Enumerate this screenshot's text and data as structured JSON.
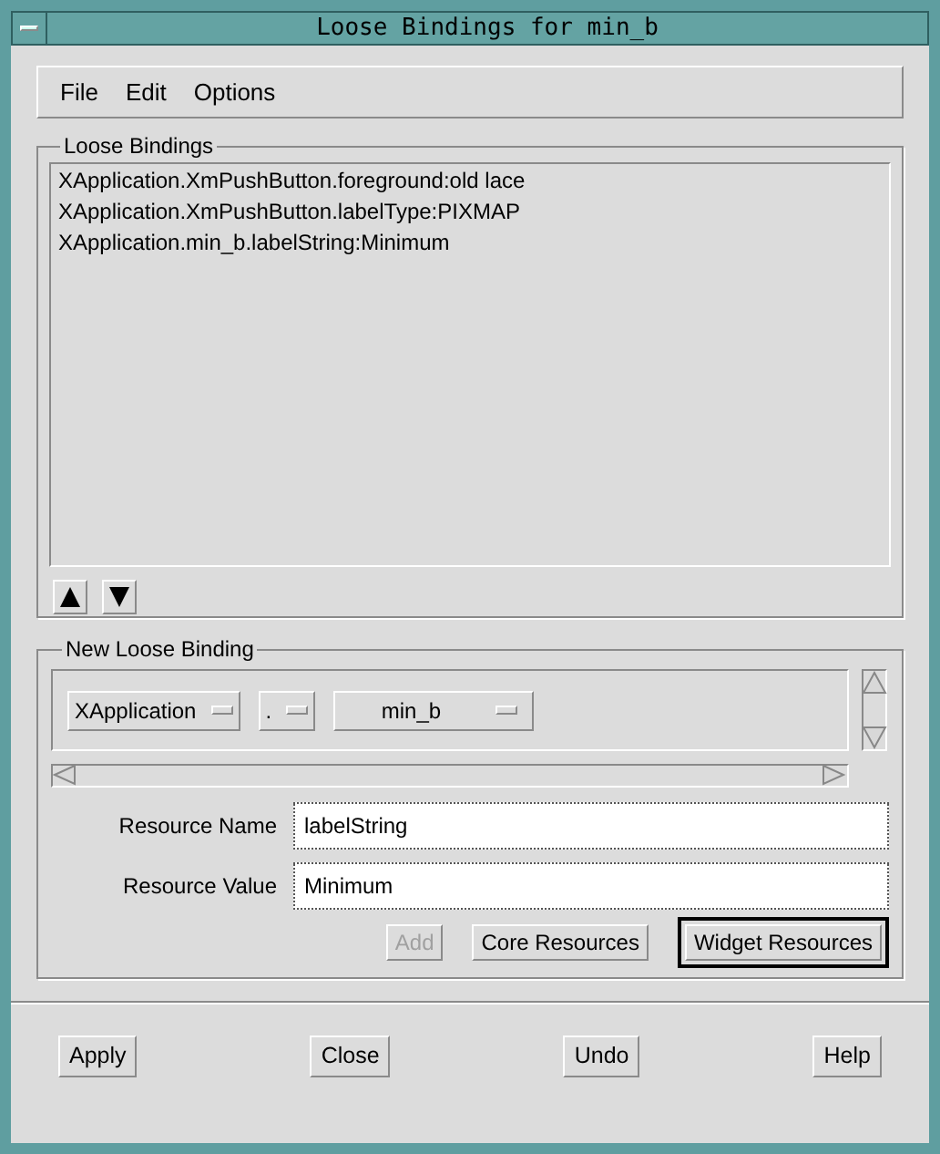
{
  "window": {
    "title": "Loose Bindings for min_b"
  },
  "menu": [
    "File",
    "Edit",
    "Options"
  ],
  "loose_bindings": {
    "title": "Loose Bindings",
    "items": [
      "XApplication.XmPushButton.foreground:old lace",
      "XApplication.XmPushButton.labelType:PIXMAP",
      "XApplication.min_b.labelString:Minimum"
    ]
  },
  "new_binding": {
    "title": "New Loose Binding",
    "option_menus": [
      "XApplication",
      ".",
      "min_b"
    ],
    "fields": [
      {
        "label": "Resource Name",
        "value": "labelString"
      },
      {
        "label": "Resource Value",
        "value": "Minimum"
      }
    ],
    "buttons": [
      {
        "label": "Add",
        "disabled": true,
        "default": false
      },
      {
        "label": "Core Resources",
        "disabled": false,
        "default": false
      },
      {
        "label": "Widget Resources",
        "disabled": false,
        "default": true
      }
    ]
  },
  "buttons": [
    "Apply",
    "Close",
    "Undo",
    "Help"
  ]
}
